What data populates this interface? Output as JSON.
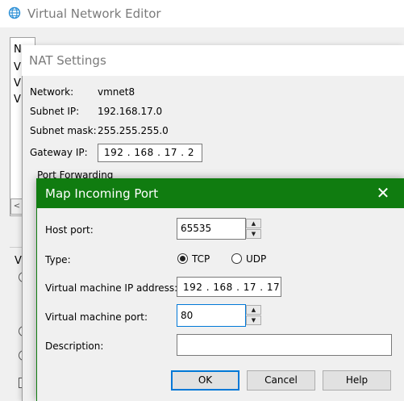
{
  "vne": {
    "title": "Virtual Network Editor",
    "list_items": [
      "N",
      "V",
      "V",
      "V"
    ],
    "side_label": "V",
    "scroll_left_glyph": "<"
  },
  "nat": {
    "title": "NAT Settings",
    "network_label": "Network:",
    "network_value": "vmnet8",
    "subnet_ip_label": "Subnet IP:",
    "subnet_ip_value": "192.168.17.0",
    "subnet_mask_label": "Subnet mask:",
    "subnet_mask_value": "255.255.255.0",
    "gateway_label": "Gateway IP:",
    "gateway_value": "192 . 168 . 17 .  2",
    "port_forwarding_label": "Port Forwarding"
  },
  "dialog": {
    "title": "Map Incoming Port",
    "close_glyph": "✕",
    "host_port_label": "Host port:",
    "host_port_value": "65535",
    "type_label": "Type:",
    "type_options": [
      "TCP",
      "UDP"
    ],
    "type_selected": "TCP",
    "vm_ip_label": "Virtual machine IP address:",
    "vm_ip_value": "192 . 168 . 17 . 17",
    "vm_port_label": "Virtual machine port:",
    "vm_port_value": "80",
    "description_label": "Description:",
    "description_value": "",
    "buttons": {
      "ok": "OK",
      "cancel": "Cancel",
      "help": "Help"
    },
    "spin_up_glyph": "▲",
    "spin_down_glyph": "▼"
  },
  "colors": {
    "dialog_titlebar": "#107c10",
    "focus_border": "#0078d7"
  },
  "icons": {
    "app_icon": "globe-network-icon",
    "close_icon": "close-icon"
  }
}
